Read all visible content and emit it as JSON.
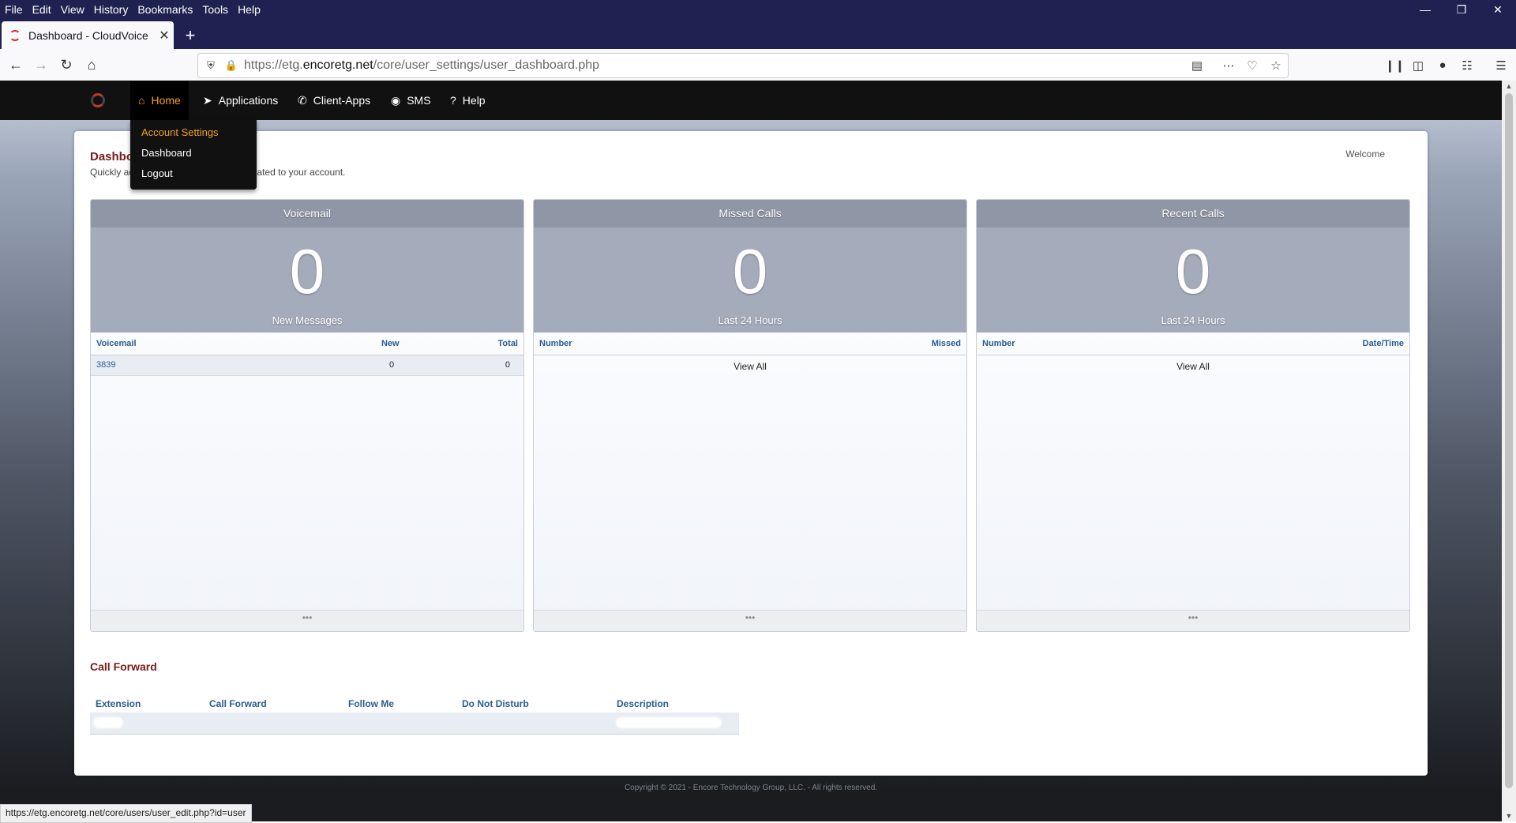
{
  "browser": {
    "menu": [
      "File",
      "Edit",
      "View",
      "History",
      "Bookmarks",
      "Tools",
      "Help"
    ],
    "tab_title": "Dashboard - CloudVoice",
    "url_prefix": "https://etg.",
    "url_domain": "encoretg.net",
    "url_path": "/core/user_settings/user_dashboard.php",
    "status_url": "https://etg.encoretg.net/core/users/user_edit.php?id=user"
  },
  "nav": {
    "items": [
      {
        "label": "Home",
        "icon": "home-icon"
      },
      {
        "label": "Applications",
        "icon": "paper-plane-icon"
      },
      {
        "label": "Client-Apps",
        "icon": "phone-icon"
      },
      {
        "label": "SMS",
        "icon": "chat-icon"
      },
      {
        "label": "Help",
        "icon": "question-icon"
      }
    ],
    "dropdown": [
      "Account Settings",
      "Dashboard",
      "Logout"
    ]
  },
  "page": {
    "title": "Dashboard",
    "subtitle": "Quickly access information and tools related to your account.",
    "welcome": "Welcome"
  },
  "cards": {
    "voicemail": {
      "title": "Voicemail",
      "count": "0",
      "label": "New Messages",
      "columns": [
        "Voicemail",
        "New",
        "Total"
      ],
      "rows": [
        {
          "voicemail": "3839",
          "new": "0",
          "total": "0"
        }
      ],
      "more": "•••"
    },
    "missed": {
      "title": "Missed Calls",
      "count": "0",
      "label": "Last 24 Hours",
      "columns": [
        "Number",
        "Missed"
      ],
      "view_all": "View All",
      "more": "•••"
    },
    "recent": {
      "title": "Recent Calls",
      "count": "0",
      "label": "Last 24 Hours",
      "columns": [
        "Number",
        "Date/Time"
      ],
      "view_all": "View All",
      "more": "•••"
    }
  },
  "call_forward": {
    "title": "Call Forward",
    "columns": [
      "Extension",
      "Call Forward",
      "Follow Me",
      "Do Not Disturb",
      "Description"
    ]
  },
  "footer": {
    "copyright": "Copyright © 2021 - Encore Technology Group, LLC. - All rights reserved."
  },
  "colors": {
    "accent": "#f2a025",
    "heading": "#7a1a1a",
    "link": "#2a5d90",
    "card_header": "#8f96a6"
  }
}
